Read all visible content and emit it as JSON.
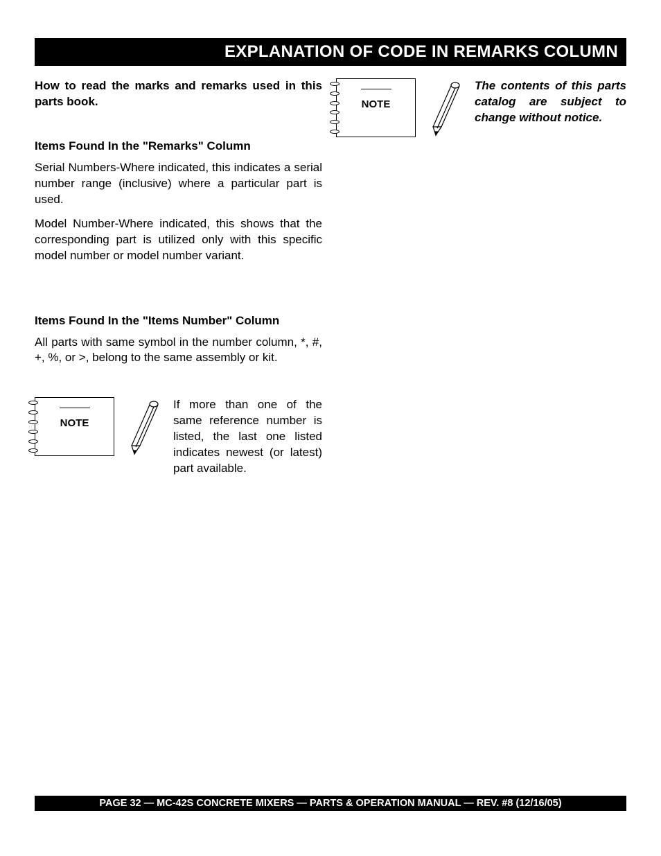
{
  "header": {
    "title": "EXPLANATION OF CODE IN REMARKS COLUMN"
  },
  "left": {
    "intro": "How to read the marks and remarks used in this parts book.",
    "section1": {
      "heading": "Items Found In the \"Remarks\" Column",
      "p1": "Serial Numbers-Where indicated, this indicates a serial number range (inclusive) where a particular part is used.",
      "p2": "Model Number-Where indicated, this shows that the corresponding part is utilized only with this specific model number or model number variant."
    },
    "section2": {
      "heading": "Items Found In the \"Items Number\" Column",
      "p1": "All parts with same symbol in the number column, *, #, +, %, or >, belong to the same assembly or kit."
    },
    "note1": {
      "label": "NOTE",
      "text": "If more than one of the same reference number is listed, the last one listed indicates newest (or latest) part available."
    }
  },
  "right": {
    "note": {
      "label": "NOTE",
      "text": "The contents of this parts catalog are subject to change without notice."
    }
  },
  "footer": {
    "text": "PAGE 32 — MC-42S   CONCRETE MIXERS — PARTS & OPERATION MANUAL — REV. #8 (12/16/05)"
  }
}
